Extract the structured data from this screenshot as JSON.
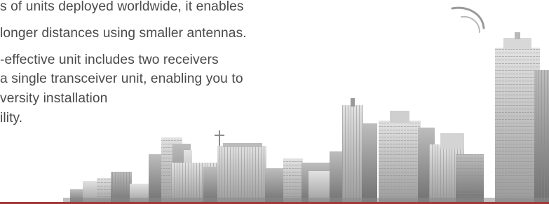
{
  "description_block": {
    "lines": [
      "s of units deployed worldwide, it enables",
      "longer distances using smaller antennas.",
      "-effective unit includes two receivers",
      "a single transceiver unit, enabling you to",
      "versity installation",
      "ility."
    ]
  },
  "colors": {
    "text": "#4a4a4a",
    "accent_rule": "#a23a39",
    "skyline_light": "#d6d6d6",
    "skyline_dark": "#7b7b7b"
  },
  "icons": {
    "swoosh": "swoosh-mark-icon",
    "skyline": "city-skyline-illustration"
  }
}
